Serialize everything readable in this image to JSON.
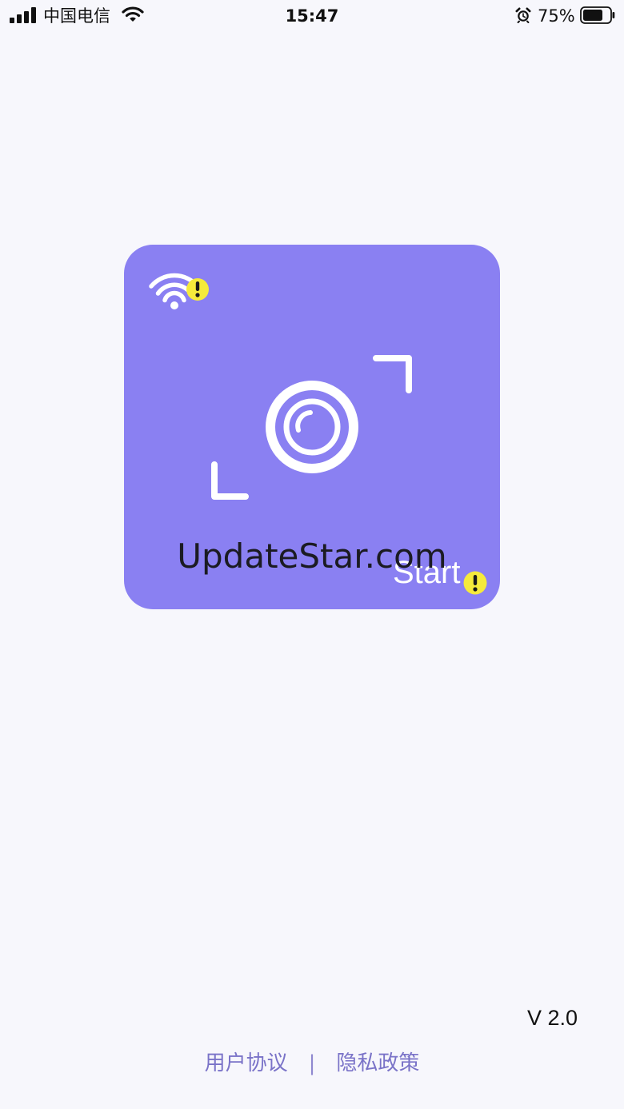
{
  "status_bar": {
    "carrier": "中国电信",
    "time": "15:47",
    "battery_percent": "75%",
    "battery_level": 0.75,
    "icons": [
      "signal-icon",
      "wifi-icon",
      "alarm-icon",
      "battery-icon"
    ]
  },
  "card": {
    "start_label": "Start",
    "watermark": "UpdateStar.com",
    "background_color": "#8a80f2",
    "warning_color": "#f5ea3b",
    "icons": [
      "wifi-warning-icon",
      "camera-scan-icon",
      "warning-icon"
    ]
  },
  "version": "V 2.0",
  "footer": {
    "user_agreement": "用户协议",
    "separator": "|",
    "privacy_policy": "隐私政策",
    "link_color": "#7a73c8"
  }
}
